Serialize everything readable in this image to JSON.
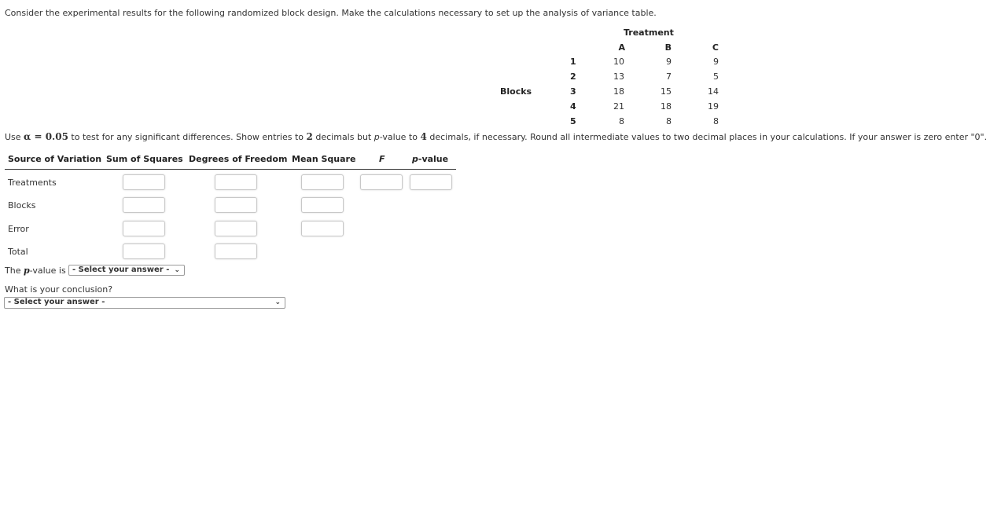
{
  "intro": "Consider the experimental results for the following randomized block design. Make the calculations necessary to set up the analysis of variance table.",
  "data_table": {
    "treatment_title": "Treatment",
    "treatments": [
      "A",
      "B",
      "C"
    ],
    "blocks_label": "Blocks",
    "blocks": [
      {
        "block": "1",
        "values": [
          "10",
          "9",
          "9"
        ]
      },
      {
        "block": "2",
        "values": [
          "13",
          "7",
          "5"
        ]
      },
      {
        "block": "3",
        "values": [
          "18",
          "15",
          "14"
        ]
      },
      {
        "block": "4",
        "values": [
          "21",
          "18",
          "19"
        ]
      },
      {
        "block": "5",
        "values": [
          "8",
          "8",
          "8"
        ]
      }
    ]
  },
  "instructions": {
    "p1": "Use ",
    "alpha": "α = 0.05",
    "p2": " to test for any significant differences. Show entries to ",
    "two": "2",
    "p3": " decimals but ",
    "p_ital": "p",
    "p4": "-value to ",
    "four": "4",
    "p5": " decimals, if necessary. Round all intermediate values to two decimal places in your calculations. If your answer is zero enter \"0\"."
  },
  "anova": {
    "headers": {
      "source": "Source of Variation",
      "ss": "Sum of Squares",
      "df": "Degrees of Freedom",
      "ms": "Mean Square",
      "f": "F",
      "p_ital": "p",
      "p_rest": "-value"
    },
    "rows": [
      {
        "label": "Treatments",
        "ss": "",
        "df": "",
        "ms": "",
        "f": "",
        "p": ""
      },
      {
        "label": "Blocks",
        "ss": "",
        "df": "",
        "ms": ""
      },
      {
        "label": "Error",
        "ss": "",
        "df": "",
        "ms": ""
      },
      {
        "label": "Total",
        "ss": "",
        "df": ""
      }
    ]
  },
  "pvalue_question": {
    "prefix": "The ",
    "p": "p",
    "suffix": "-value is",
    "selected": "- Select your answer -"
  },
  "conclusion_question": {
    "label": "What is your conclusion?",
    "selected": "- Select your answer -"
  }
}
